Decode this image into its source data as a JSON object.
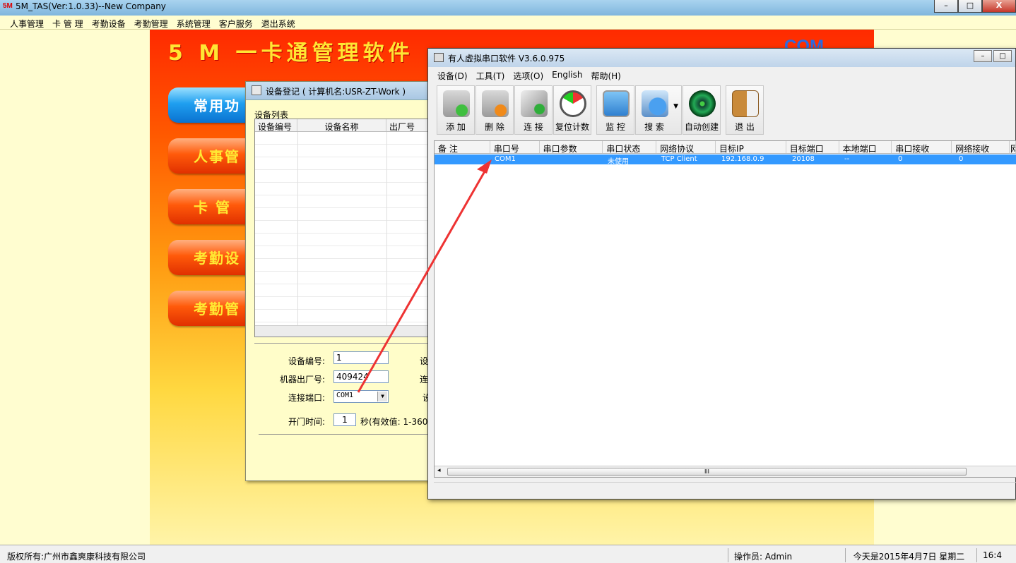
{
  "main_window": {
    "title": "5M_TAS(Ver:1.0.33)--New Company",
    "icon_text": "5M",
    "menu": [
      "人事管理",
      "卡 管 理",
      "考勤设备",
      "考勤管理",
      "系统管理",
      "客户服务",
      "退出系统"
    ],
    "min_label": "–",
    "max_label": "□",
    "close_label": "X"
  },
  "banner": {
    "title": "5 M 一卡通管理软件",
    "logo": "COM",
    "buttons": [
      "常用功",
      "人事管",
      "卡 管",
      "考勤设",
      "考勤管"
    ]
  },
  "device_dialog": {
    "title": "设备登记 ( 计算机名:USR-ZT-Work )",
    "list_label": "设备列表",
    "columns": [
      "设备编号",
      "设备名称",
      "出厂号"
    ],
    "form": {
      "device_no_label": "设备编号:",
      "device_no_value": "1",
      "serial_label": "机器出厂号:",
      "serial_value": "409424",
      "port_label": "连接端口:",
      "port_value": "COM1",
      "open_time_label": "开门时间:",
      "open_time_value": "1",
      "open_time_hint": "秒(有效值: 1-360",
      "right_labels": [
        "设",
        "连",
        "设"
      ]
    }
  },
  "vsp_window": {
    "title": "有人虚拟串口软件 V3.6.0.975",
    "menu": [
      "设备(D)",
      "工具(T)",
      "选项(O)",
      "English",
      "帮助(H)"
    ],
    "toolbar": [
      "添 加",
      "删 除",
      "连 接",
      "复位计数",
      "监 控",
      "搜 索",
      "自动创建",
      "退 出"
    ],
    "columns": [
      "备 注",
      "串口号",
      "串口参数",
      "串口状态",
      "网络协议",
      "目标IP",
      "目标端口",
      "本地端口",
      "串口接收",
      "网络接收",
      "网"
    ],
    "rows": [
      {
        "note": "",
        "port": "COM1",
        "params": "",
        "status": "未使用",
        "protocol": "TCP Client",
        "target_ip": "192.168.0.9",
        "target_port": "20108",
        "local_port": "--",
        "serial_rx": "0",
        "net_rx": "0"
      }
    ],
    "scroll_grip": "III"
  },
  "status_bar": {
    "copyright": "版权所有:广州市鑫爽康科技有限公司",
    "operator": "操作员: Admin",
    "date": "今天是2015年4月7日 星期二",
    "time": "16:4"
  },
  "colors": {
    "accent_red": "#ff2a00",
    "selection_blue": "#3399ff",
    "arrow_red": "#ee3333"
  }
}
